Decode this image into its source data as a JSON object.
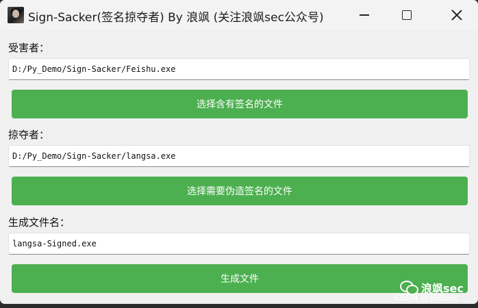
{
  "window": {
    "title": "Sign-Sacker(签名掠夺者) By 浪飒 (关注浪飒sec公众号)"
  },
  "victim": {
    "label": "受害者：",
    "path": "D:/Py_Demo/Sign-Sacker/Feishu.exe",
    "button": "选择含有签名的文件"
  },
  "plunderer": {
    "label": "掠夺者：",
    "path": "D:/Py_Demo/Sign-Sacker/langsa.exe",
    "button": "选择需要伪造签名的文件"
  },
  "output": {
    "label": "生成文件名：",
    "filename": "langsa-Signed.exe",
    "button": "生成文件"
  },
  "watermark": {
    "account": "浪飒sec",
    "csdn": "CSDN @浪飒sec"
  },
  "colors": {
    "button_green": "#4caf50",
    "window_bg": "#f0f0f0"
  }
}
